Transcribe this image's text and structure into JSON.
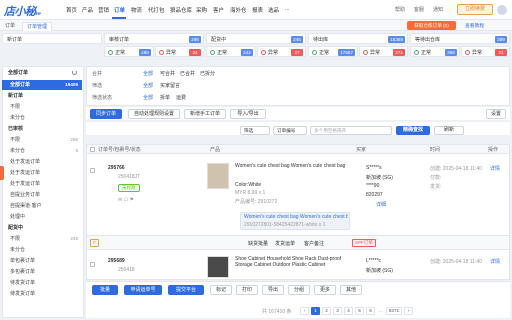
{
  "app": {
    "logo": "店小秘",
    "logo_sub": "ERP"
  },
  "nav": {
    "items": [
      "首页",
      "产品",
      "营销",
      "订单",
      "物流",
      "代打包",
      "狼品仓库",
      "采购",
      "客户",
      "海外仓",
      "报表",
      "选品",
      "..."
    ],
    "active_index": 3,
    "right": {
      "help": "帮助",
      "service": "客服",
      "notice": "通知"
    },
    "vip_button": "立即续费"
  },
  "tabs": {
    "items": [
      "订单",
      "订单管理"
    ],
    "active_index": 1,
    "warn_button": "获取仓拣订单 (0)",
    "tutorial": "查看教程"
  },
  "status_cards_row1": [
    {
      "label": "新订单",
      "count": ""
    },
    {
      "label": "审核订单",
      "count": "295"
    },
    {
      "label": "配货中",
      "count": "245"
    },
    {
      "label": "待出库",
      "count": "18386"
    },
    {
      "label": "等待出仓库",
      "count": "389"
    }
  ],
  "status_cards_row2": [
    {
      "label": "正常",
      "count": "288",
      "count2": "24",
      "label2": "异常"
    },
    {
      "label": "正常",
      "count": "242",
      "count2": "27",
      "label2": "异常"
    },
    {
      "label": "正常",
      "count": "16",
      "count2": "1",
      "label2": "异常"
    },
    {
      "label": "正常",
      "count": "17667",
      "count2": "371",
      "label2": "异常"
    },
    {
      "label": "正常",
      "count": "368",
      "count2": "21",
      "label2": "异常"
    }
  ],
  "sidebar": {
    "header": "全部订单",
    "items": [
      {
        "label": "全部订单",
        "count": "19409",
        "active": true
      },
      {
        "label": "新订单",
        "count": "",
        "header": true
      },
      {
        "label": "不限",
        "count": ""
      },
      {
        "label": "未分仓",
        "count": ""
      },
      {
        "label": "已审核",
        "count": "",
        "header": true
      },
      {
        "label": "不限",
        "count": "295"
      },
      {
        "label": "未分仓",
        "count": "8"
      },
      {
        "label": "处于发运订单",
        "count": ""
      },
      {
        "label": "处于发运订单",
        "count": ""
      },
      {
        "label": "处于发运订单",
        "count": ""
      },
      {
        "label": "自提业务订单",
        "count": ""
      },
      {
        "label": "自提渠道·客户",
        "count": ""
      },
      {
        "label": "处理中",
        "count": ""
      },
      {
        "label": "配货中",
        "count": "",
        "header": true
      },
      {
        "label": "不限",
        "count": "245"
      },
      {
        "label": "未分仓",
        "count": ""
      },
      {
        "label": "单包裹订单",
        "count": ""
      },
      {
        "label": "多包裹订单",
        "count": ""
      },
      {
        "label": "待发货订单",
        "count": ""
      },
      {
        "label": "待发货订单",
        "count": ""
      }
    ]
  },
  "filters": {
    "row1": {
      "label": "合并",
      "options": [
        "全部",
        "可合并",
        "已合并",
        "已拆分"
      ]
    },
    "row2": {
      "label": "筛选",
      "options": [
        "全部",
        "买家留言"
      ]
    },
    "row3": {
      "label": "筛选状态",
      "options": [
        "全部",
        "拆单",
        "运费"
      ]
    }
  },
  "toolbar": {
    "sync": "同步订单",
    "buttons": [
      "自动处理规则设置",
      "新增手工订单",
      "导入/导出"
    ],
    "settings": "设置"
  },
  "search": {
    "select1": "筛选",
    "select2": "订单编号",
    "placeholder": "多个用空格隔开",
    "search_btn": "精确查找",
    "reset": "刷新"
  },
  "table": {
    "headers": [
      "订单号/包裹号/状态",
      "产品",
      "买家",
      "时间",
      "操作"
    ],
    "rows": [
      {
        "order_no": "295766",
        "package": "250418JT",
        "tag": "未付款",
        "product_title": "Women's cute chest bag Women's cute chest bag",
        "product_extra": "Color:White",
        "sku": "MYR 8.99 x 1",
        "sku2": "产品编号: 2910272",
        "variant_note": "Women's cute chest bag Women's cute chest bag",
        "variant_code": "2910272801-58425422871-white x 1",
        "buyer_name": "S*****s",
        "buyer_country": "新加坡 (SG)",
        "buyer_phone": "****90",
        "buyer_zip": "820297",
        "buyer_action": "详细",
        "created": "创建: 2025-04-18 11:40",
        "paid": "付款:",
        "ship": "发货:",
        "action_link": "详情",
        "footer": [
          "缺货批量",
          "发货运单",
          "客户备注",
          "SPF订单"
        ]
      },
      {
        "order_no": "295689",
        "package": "250418",
        "product_title": "Shoe Cabinet Household Shoe Rack Dust-proof Storage Cabinet Outdoor Plastic Cabinet",
        "buyer_name": "L*****c",
        "buyer_country": "新加坡 (SG)",
        "created": "创建: 2025-04-18 11:40",
        "action_link": "详情"
      }
    ]
  },
  "bottom": {
    "buttons": [
      "批量",
      "申请运单号",
      "提交平台",
      "标记",
      "打印",
      "导出",
      "分组",
      "更多",
      "其他"
    ],
    "total": "共 167410 条",
    "pages": [
      "1",
      "2",
      "3",
      "4",
      "5",
      "6",
      "8371"
    ],
    "current_page": "1"
  }
}
